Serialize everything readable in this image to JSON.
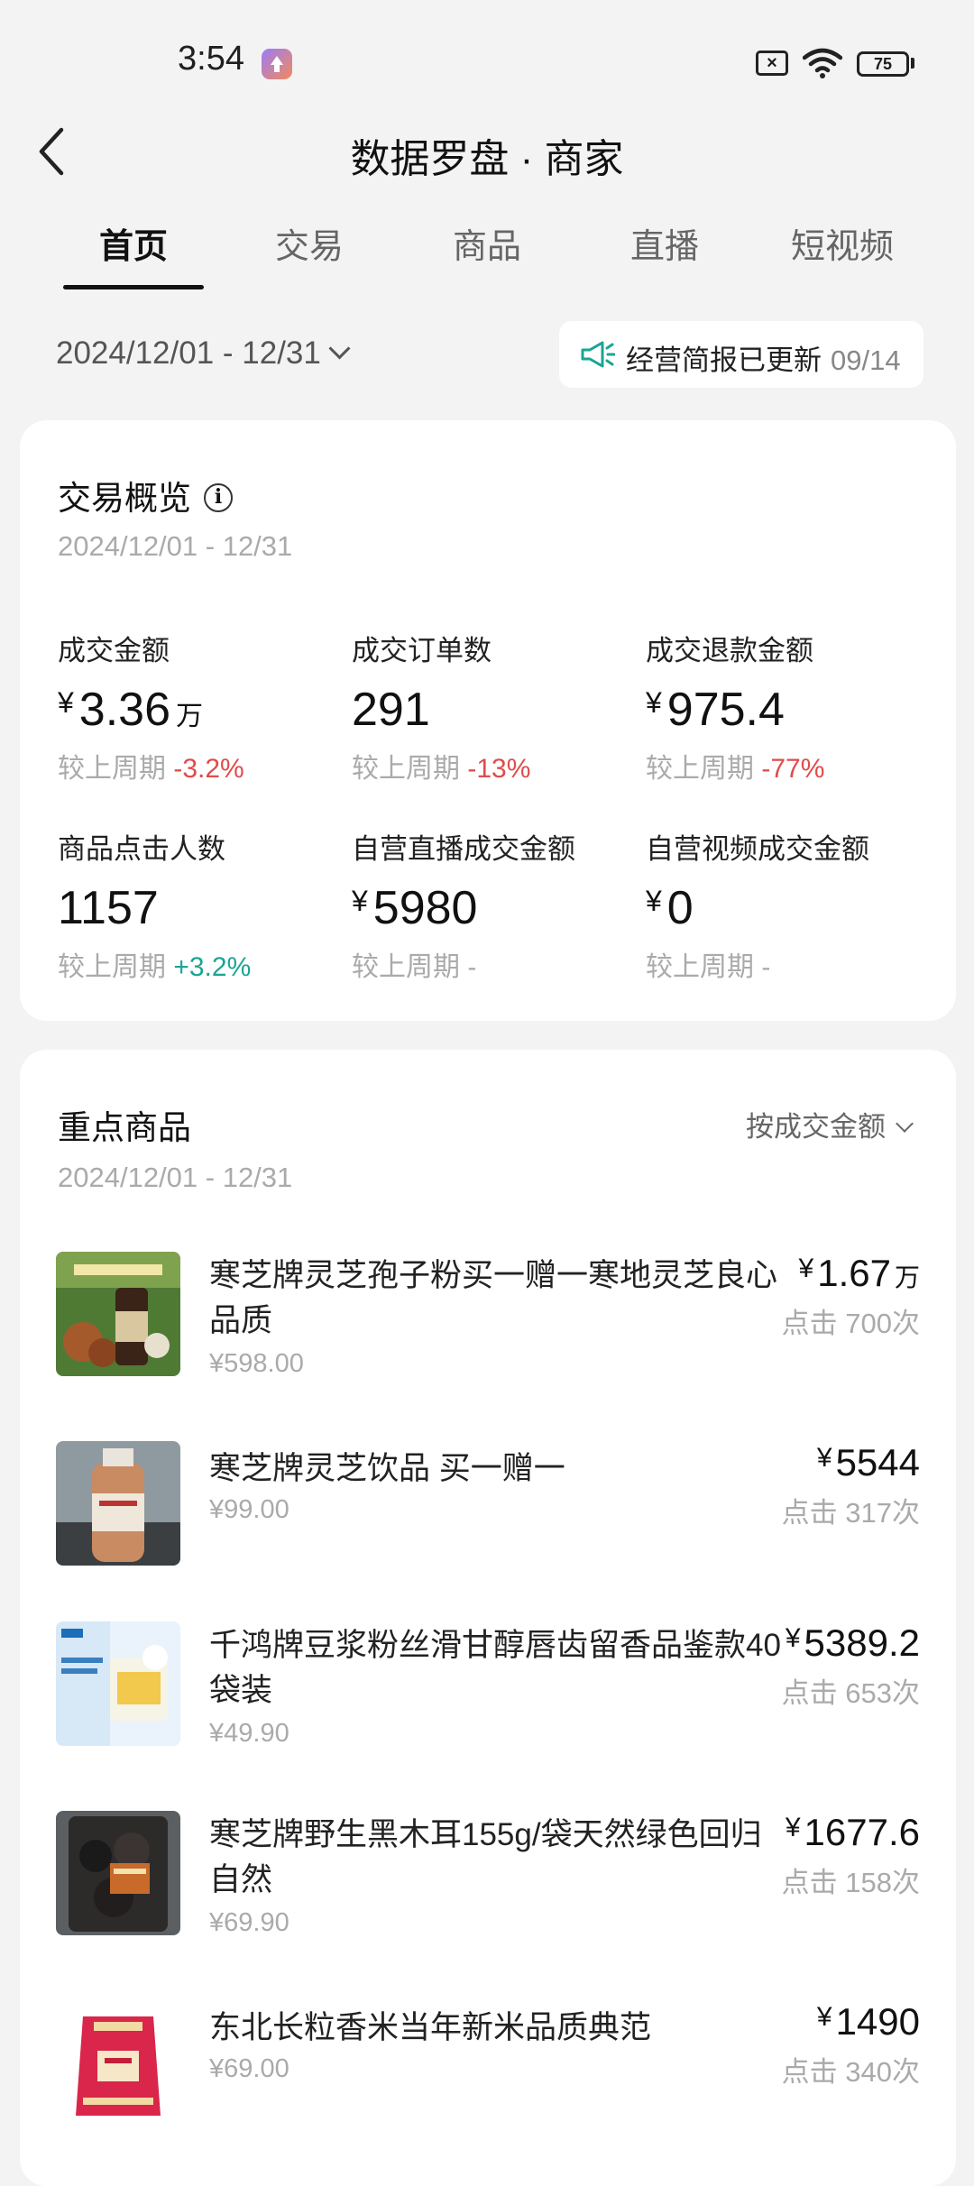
{
  "status_bar": {
    "time": "3:54",
    "battery": "75"
  },
  "header": {
    "title": "数据罗盘 · 商家"
  },
  "tabs": [
    {
      "label": "首页",
      "active": true
    },
    {
      "label": "交易",
      "active": false
    },
    {
      "label": "商品",
      "active": false
    },
    {
      "label": "直播",
      "active": false
    },
    {
      "label": "短视频",
      "active": false
    }
  ],
  "date_filter": {
    "label": "2024/12/01 - 12/31"
  },
  "notice": {
    "text": "经营简报已更新",
    "date": "09/14"
  },
  "overview": {
    "title": "交易概览",
    "date": "2024/12/01 - 12/31",
    "compare_label": "较上周期",
    "metrics": [
      {
        "label": "成交金额",
        "currency": "¥",
        "value": "3.36",
        "unit": "万",
        "change": "-3.2%",
        "trend": "neg"
      },
      {
        "label": "成交订单数",
        "currency": "",
        "value": "291",
        "unit": "",
        "change": "-13%",
        "trend": "neg"
      },
      {
        "label": "成交退款金额",
        "currency": "¥",
        "value": "975.4",
        "unit": "",
        "change": "-77%",
        "trend": "neg"
      },
      {
        "label": "商品点击人数",
        "currency": "",
        "value": "1157",
        "unit": "",
        "change": "+3.2%",
        "trend": "pos"
      },
      {
        "label": "自营直播成交金额",
        "currency": "¥",
        "value": "5980",
        "unit": "",
        "change": "-",
        "trend": "none"
      },
      {
        "label": "自营视频成交金额",
        "currency": "¥",
        "value": "0",
        "unit": "",
        "change": "-",
        "trend": "none"
      }
    ]
  },
  "key_products": {
    "title": "重点商品",
    "date": "2024/12/01 - 12/31",
    "sort_label": "按成交金额",
    "items": [
      {
        "name": "寒芝牌灵芝孢子粉买一赠一寒地灵芝良心品质",
        "price": "¥598.00",
        "amount": "1.67",
        "unit": "万",
        "clicks": "点击 700次",
        "thumb": "spore-powder"
      },
      {
        "name": "寒芝牌灵芝饮品 买一赠一",
        "price": "¥99.00",
        "amount": "5544",
        "unit": "",
        "clicks": "点击 317次",
        "thumb": "drink-bottle"
      },
      {
        "name": "千鸿牌豆浆粉丝滑甘醇唇齿留香品鉴款40袋装",
        "price": "¥49.90",
        "amount": "5389.2",
        "unit": "",
        "clicks": "点击 653次",
        "thumb": "soy-milk"
      },
      {
        "name": "寒芝牌野生黑木耳155g/袋天然绿色回归自然",
        "price": "¥69.90",
        "amount": "1677.6",
        "unit": "",
        "clicks": "点击 158次",
        "thumb": "black-fungus"
      },
      {
        "name": "东北长粒香米当年新米品质典范",
        "price": "¥69.00",
        "amount": "1490",
        "unit": "",
        "clicks": "点击 340次",
        "thumb": "rice-bag"
      }
    ]
  }
}
